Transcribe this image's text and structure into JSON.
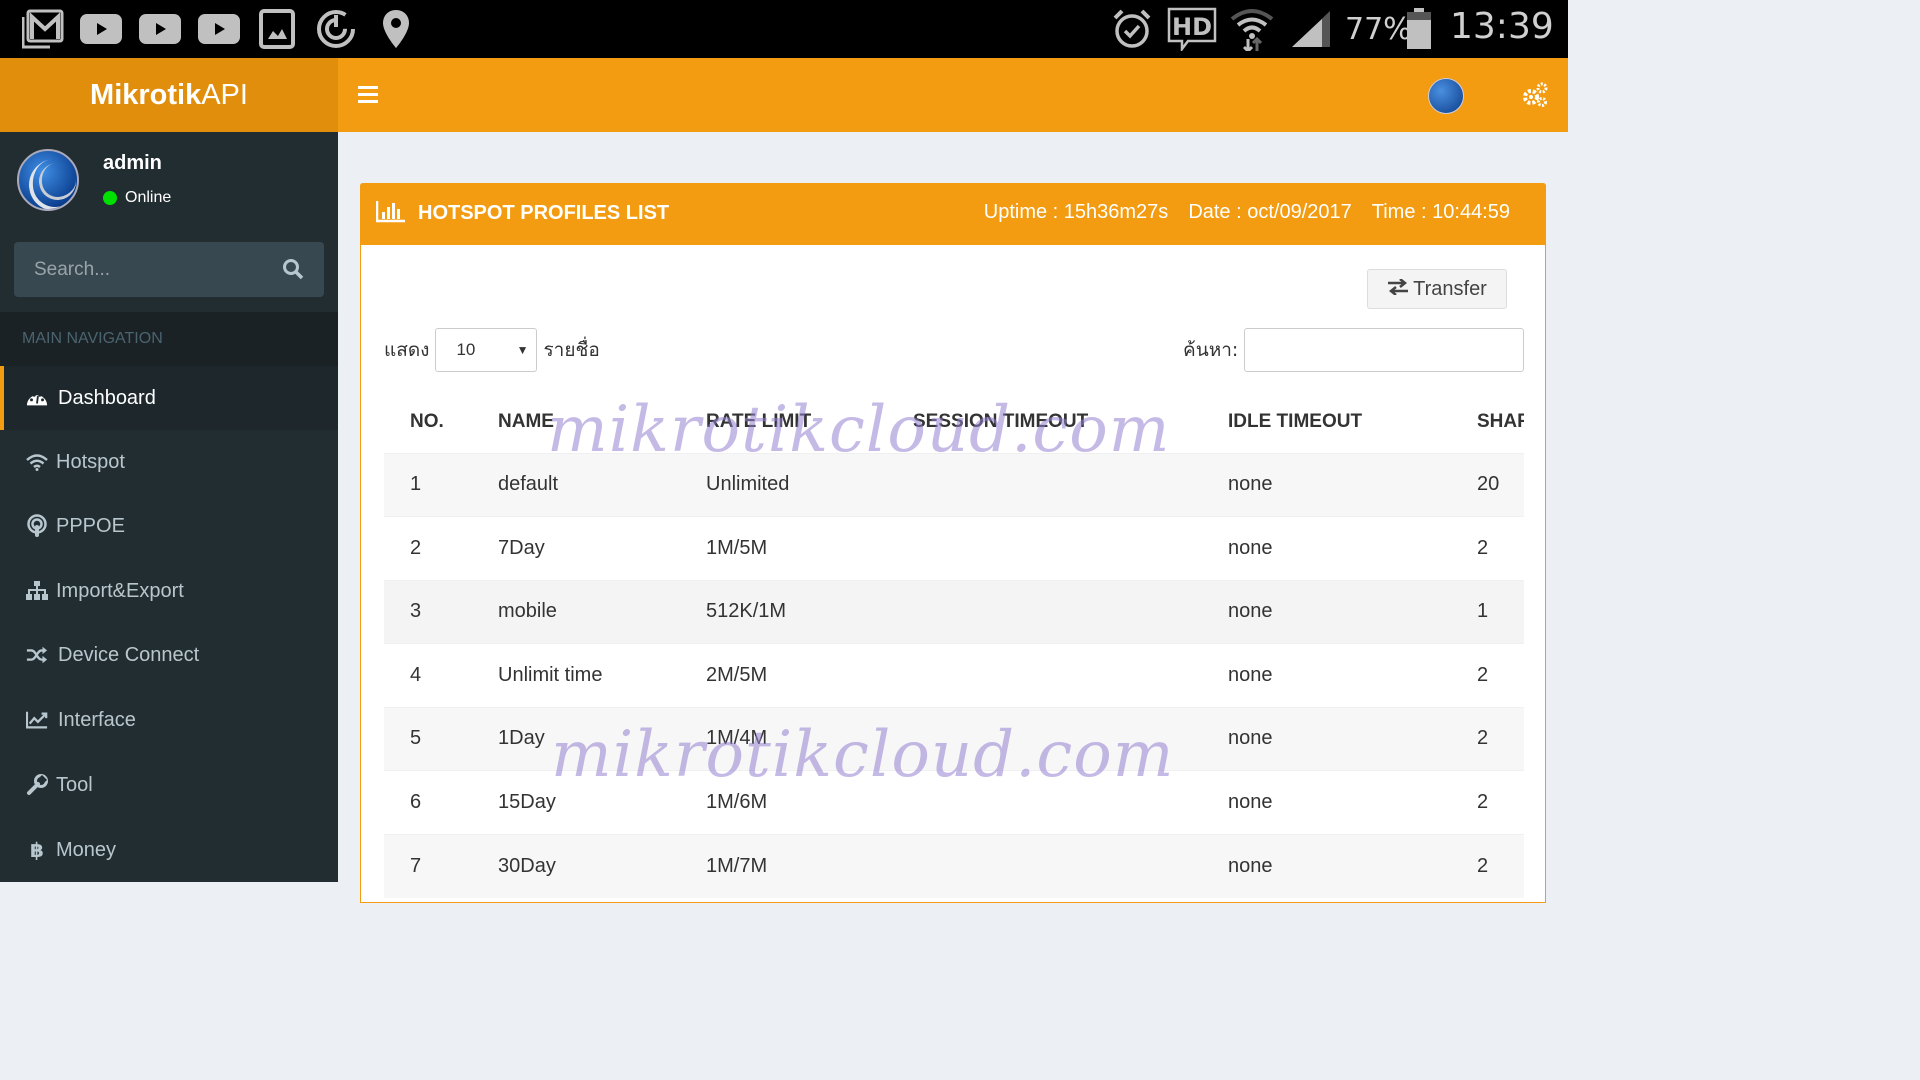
{
  "status_bar": {
    "left_icons": [
      "gmail-icon",
      "youtube-icon",
      "youtube-icon",
      "youtube-icon",
      "gallery-icon",
      "sync-icon",
      "location-icon"
    ],
    "right_icons": [
      "alarm-icon",
      "hd-voice-icon",
      "wifi-icon",
      "signal-icon"
    ],
    "battery": "77%",
    "time": "13:39"
  },
  "header": {
    "logo_bold": "Mikrotik",
    "logo_light": "API"
  },
  "sidebar": {
    "user": {
      "name": "admin",
      "status": "Online",
      "status_color": "#00e000"
    },
    "search_placeholder": "Search...",
    "nav_header": "MAIN NAVIGATION",
    "items": [
      {
        "label": "Dashboard",
        "icon": "dashboard-icon",
        "active": true
      },
      {
        "label": "Hotspot",
        "icon": "wifi-icon"
      },
      {
        "label": "PPPOE",
        "icon": "podcast-icon"
      },
      {
        "label": "Import&Export",
        "icon": "sitemap-icon"
      },
      {
        "label": "Device Connect",
        "icon": "random-icon"
      },
      {
        "label": "Interface",
        "icon": "line-chart-icon"
      },
      {
        "label": "Tool",
        "icon": "wrench-icon"
      },
      {
        "label": "Money",
        "icon": "baht-icon"
      }
    ]
  },
  "box": {
    "title": "HOTSPOT PROFILES LIST",
    "uptime": "Uptime : 15h36m27s",
    "date": "Date : oct/09/2017",
    "time": "Time : 10:44:59",
    "transfer_label": "Transfer",
    "length_prefix": "แสดง",
    "length_value": "10",
    "length_suffix": "รายชื่อ",
    "filter_label": "ค้นหา:",
    "filter_value": ""
  },
  "table": {
    "columns": [
      "NO.",
      "NAME",
      "RATE LIMIT",
      "SESSION TIMEOUT",
      "IDLE TIMEOUT",
      "SHARED USERS"
    ],
    "rows": [
      [
        "1",
        "default",
        "Unlimited",
        "",
        "none",
        "20"
      ],
      [
        "2",
        "7Day",
        "1M/5M",
        "",
        "none",
        "2"
      ],
      [
        "3",
        "mobile",
        "512K/1M",
        "",
        "none",
        "1"
      ],
      [
        "4",
        "Unlimit time",
        "2M/5M",
        "",
        "none",
        "2"
      ],
      [
        "5",
        "1Day",
        "1M/4M",
        "",
        "none",
        "2"
      ],
      [
        "6",
        "15Day",
        "1M/6M",
        "",
        "none",
        "2"
      ],
      [
        "7",
        "30Day",
        "1M/7M",
        "",
        "none",
        "2"
      ]
    ]
  },
  "watermark": "mikrotikcloud.com",
  "colors": {
    "accent": "#f39c12",
    "accent_dark": "#e08e0b",
    "sidebar": "#222d32"
  }
}
